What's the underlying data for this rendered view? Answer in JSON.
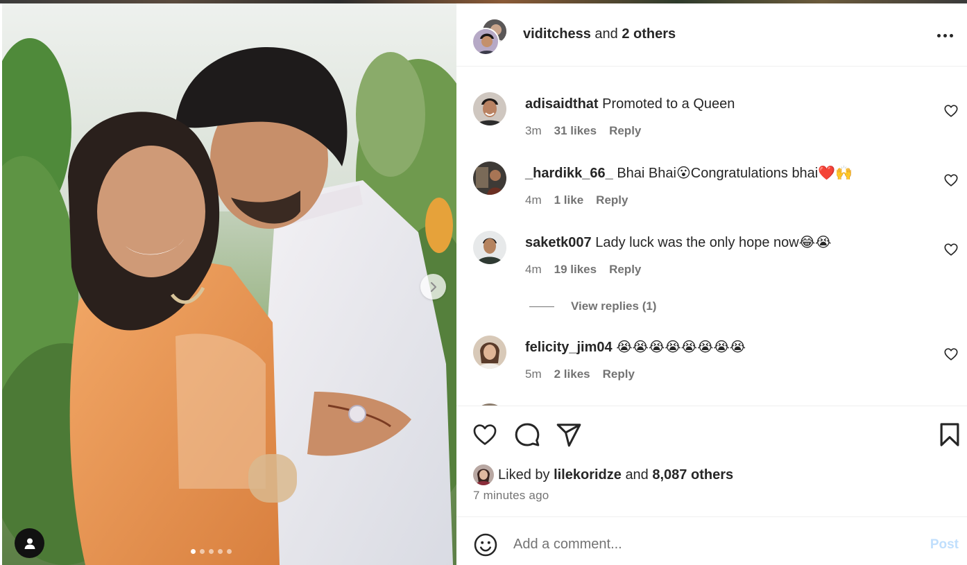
{
  "header": {
    "username": "viditchess",
    "connector": "and",
    "others": "2 others"
  },
  "comments": [
    {
      "username": "adisaidthat",
      "text": "Promoted to a Queen",
      "time": "3m",
      "likes": "31 likes",
      "reply": "Reply"
    },
    {
      "username": "_hardikk_66_",
      "text": "Bhai Bhai😮Congratulations bhai❤️🙌",
      "time": "4m",
      "likes": "1 like",
      "reply": "Reply"
    },
    {
      "username": "saketk007",
      "text": "Lady luck was the only hope now😂😭",
      "time": "4m",
      "likes": "19 likes",
      "reply": "Reply"
    },
    {
      "username": "felicity_jim04",
      "text": "😭😭😭😭😭😭😭😭",
      "time": "5m",
      "likes": "2 likes",
      "reply": "Reply"
    }
  ],
  "view_replies": "View replies (1)",
  "likes": {
    "prefix": "Liked by",
    "user": "lilekoridze",
    "connector": "and",
    "others": "8,087 others"
  },
  "time_ago": "7 minutes ago",
  "comment_box": {
    "placeholder": "Add a comment...",
    "post_label": "Post"
  },
  "carousel": {
    "slide_count": 5,
    "active_index": 0
  },
  "colors": {
    "text": "#262626",
    "secondary": "#737373",
    "post_disabled": "#c0dffd",
    "divider": "#efefef"
  },
  "icons": [
    "more-icon",
    "heart-icon",
    "comment-icon",
    "share-icon",
    "bookmark-icon",
    "emoji-icon",
    "chevron-right-icon",
    "user-tag-icon"
  ]
}
